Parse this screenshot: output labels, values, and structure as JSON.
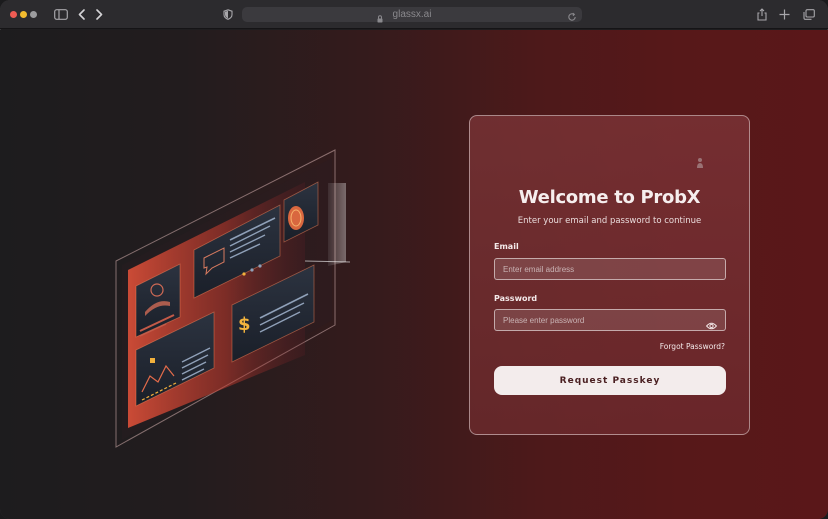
{
  "browser": {
    "url": "glassx.ai",
    "icons": [
      "sidebar-icon",
      "back-icon",
      "forward-icon",
      "shield-icon",
      "lock-icon",
      "reload-icon",
      "share-icon",
      "new-tab-icon",
      "tabs-icon"
    ]
  },
  "login": {
    "title": "Welcome to ProbX",
    "subtitle": "Enter your email and password to continue",
    "email_label": "Email",
    "email_placeholder": "Enter email address",
    "email_value": "",
    "password_label": "Password",
    "password_placeholder": "Please enter password",
    "password_value": "",
    "forgot_label": "Forgot Password?",
    "submit_label": "Request Passkey"
  },
  "colors": {
    "accent": "#e85a3a",
    "card_border": "#d8b9ba",
    "button_bg": "#f3ecec",
    "button_text": "#4a1f21"
  }
}
